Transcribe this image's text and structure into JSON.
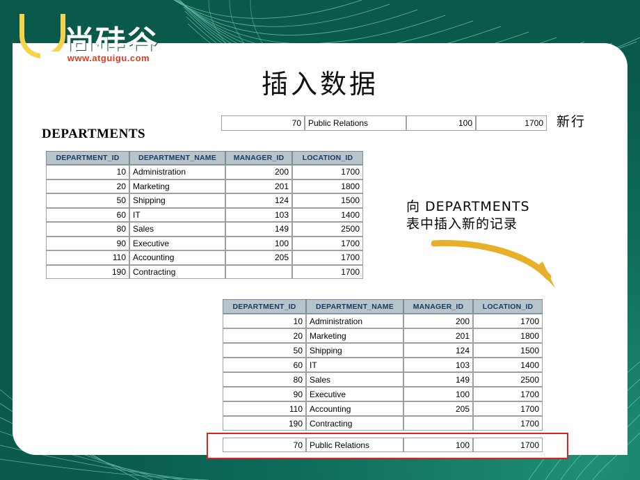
{
  "logo": {
    "brand_cn": "尚硅谷",
    "url": "www.atguigu.com",
    "mark": "u-letter-logo"
  },
  "slide": {
    "title": "插入数据",
    "section_label": "DEPARTMENTS",
    "annotation_new_row": "新行",
    "annotation_insert_line1": "向  DEPARTMENTS",
    "annotation_insert_line2": "表中插入新的记录"
  },
  "columns": [
    "DEPARTMENT_ID",
    "DEPARTMENT_NAME",
    "MANAGER_ID",
    "LOCATION_ID"
  ],
  "new_row": [
    "70",
    "Public Relations",
    "100",
    "1700"
  ],
  "rows_upper": [
    [
      "10",
      "Administration",
      "200",
      "1700"
    ],
    [
      "20",
      "Marketing",
      "201",
      "1800"
    ],
    [
      "50",
      "Shipping",
      "124",
      "1500"
    ],
    [
      "60",
      "IT",
      "103",
      "1400"
    ],
    [
      "80",
      "Sales",
      "149",
      "2500"
    ],
    [
      "90",
      "Executive",
      "100",
      "1700"
    ],
    [
      "110",
      "Accounting",
      "205",
      "1700"
    ],
    [
      "190",
      "Contracting",
      "",
      "1700"
    ]
  ],
  "rows_lower": [
    [
      "10",
      "Administration",
      "200",
      "1700"
    ],
    [
      "20",
      "Marketing",
      "201",
      "1800"
    ],
    [
      "50",
      "Shipping",
      "124",
      "1500"
    ],
    [
      "60",
      "IT",
      "103",
      "1400"
    ],
    [
      "80",
      "Sales",
      "149",
      "2500"
    ],
    [
      "90",
      "Executive",
      "100",
      "1700"
    ],
    [
      "110",
      "Accounting",
      "205",
      "1700"
    ],
    [
      "190",
      "Contracting",
      "",
      "1700"
    ]
  ],
  "colors": {
    "background_green": "#0e6b5c",
    "header_blue_gray": "#b8c4cc",
    "header_text": "#173a5e",
    "highlight_red": "#d8251d",
    "arrow_gold": "#e8b02a",
    "logo_yellow": "#f6d34a",
    "url_red": "#e03a1f"
  }
}
